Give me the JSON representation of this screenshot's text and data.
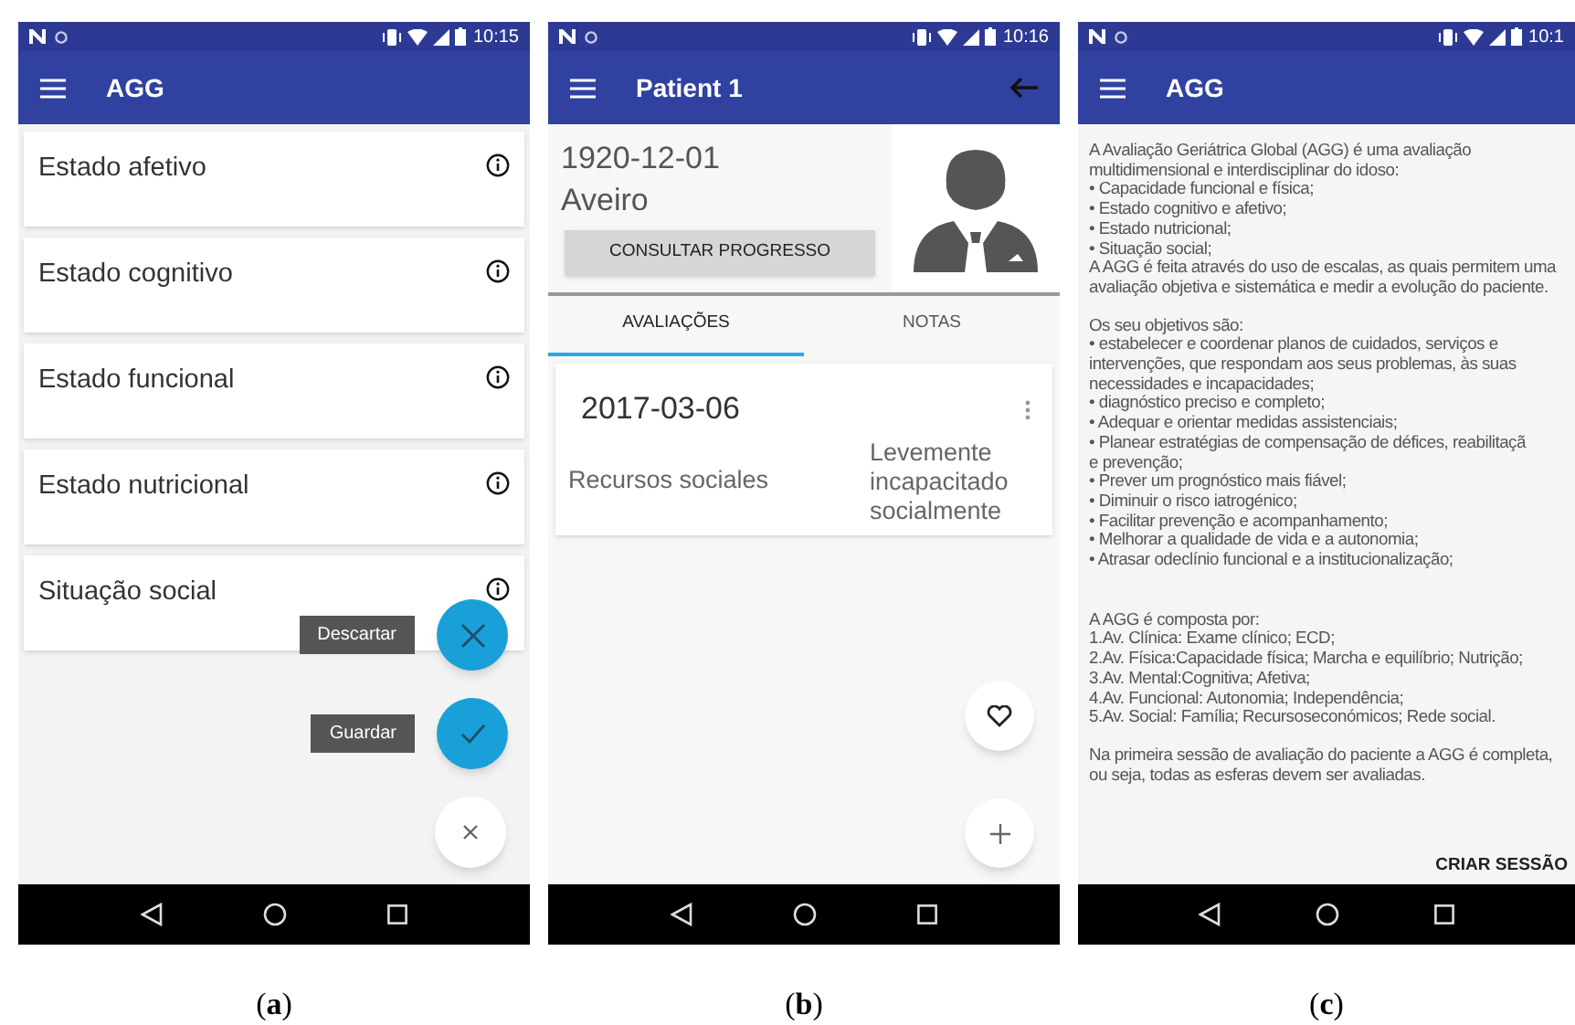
{
  "panels": [
    {
      "kind": "categories",
      "status_time": "10:15",
      "title": "AGG",
      "caption": "(**a**)",
      "items": [
        {
          "label": "Estado afetivo"
        },
        {
          "label": "Estado cognitivo"
        },
        {
          "label": "Estado funcional"
        },
        {
          "label": "Estado nutricional"
        },
        {
          "label": "Situação social"
        }
      ],
      "fab_actions": [
        {
          "kind": "discard",
          "label": "Descartar"
        },
        {
          "kind": "save",
          "label": "Guardar"
        }
      ]
    },
    {
      "kind": "patient",
      "status_time": "10:16",
      "title": "Patient 1",
      "caption": "(**b**)",
      "birth_date": "1920-12-01",
      "location": "Aveiro",
      "progress_button": "CONSULTAR PROGRESSO",
      "tabs": [
        {
          "label": "AVALIAÇÕES",
          "selected": true
        },
        {
          "label": "NOTAS",
          "selected": false
        }
      ],
      "assessments": [
        {
          "date": "2017-03-06",
          "domain": "Recursos sociales",
          "result": "Levemente incapacitado socialmente"
        }
      ]
    },
    {
      "kind": "info",
      "status_time": "10:1",
      "title": "AGG",
      "caption": "(**c**)",
      "create_button": "CRIAR SESSÃO",
      "sections": [
        [
          "A Avaliação Geriátrica Global (AGG) é uma avaliação multidimensional e interdisciplinar do idoso:",
          "• Capacidade funcional e física;",
          "• Estado cognitivo e afetivo;",
          "• Estado nutricional;",
          "• Situação social;",
          "A AGG é feita através do uso de escalas, as quais permitem uma avaliação objetiva e sistemática e medir a evolução do paciente."
        ],
        [
          "Os seu objetivos são:",
          "• estabelecer e coordenar planos de cuidados, serviços e intervenções, que respondam aos seus problemas, às suas necessidades e incapacidades;",
          "• diagnóstico preciso e completo;",
          "• Adequar e orientar medidas assistenciais;",
          "• Planear estratégias de compensação de défices, reabilitaçã",
          "e prevenção;",
          "• Prever um prognóstico mais fiável;",
          "• Diminuir o risco iatrogénico;",
          "• Facilitar prevenção e acompanhamento;",
          "• Melhorar a qualidade de vida e a autonomia;",
          "• Atrasar odeclínio funcional e a institucionalização;"
        ],
        [
          "A AGG é composta por:",
          "1.Av. Clínica: Exame clínico; ECD;",
          "2.Av. Física:Capacidade física; Marcha e equilíbrio; Nutrição;",
          "3.Av. Mental:Cognitiva; Afetiva;",
          "4.Av. Funcional: Autonomia; Independência;",
          "5.Av. Social: Família; Recursoseconómicos; Rede social."
        ],
        [
          "Na primeira sessão de avaliação do paciente a AGG é completa, ou seja, todas as esferas devem ser avaliadas."
        ]
      ]
    }
  ]
}
